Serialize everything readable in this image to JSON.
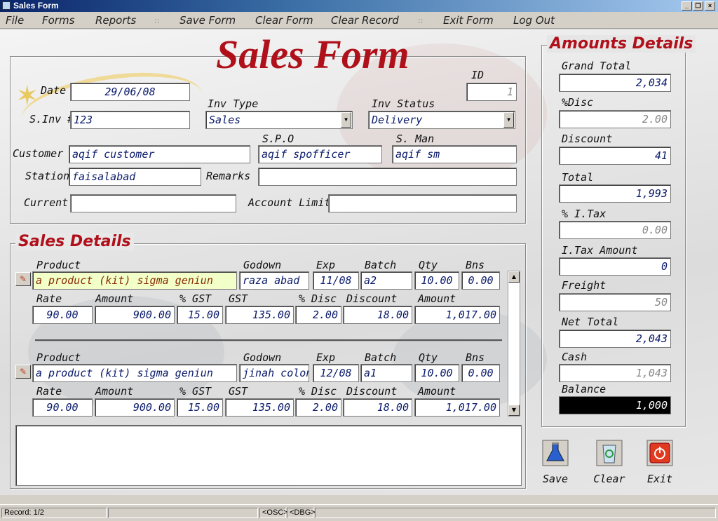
{
  "window": {
    "title": "Sales Form"
  },
  "menu": [
    {
      "label": "File"
    },
    {
      "label": "Forms"
    },
    {
      "label": "Reports"
    },
    {
      "label": "Save Form"
    },
    {
      "label": "Clear Form"
    },
    {
      "label": "Clear Record"
    },
    {
      "label": "Exit Form"
    },
    {
      "label": "Log Out"
    }
  ],
  "header": {
    "title": "Sales Form",
    "date_label": "Date",
    "date": "29/06/08",
    "id_label": "ID",
    "id": "1",
    "inv_type_label": "Inv Type",
    "inv_type": "Sales",
    "inv_status_label": "Inv Status",
    "inv_status": "Delivery",
    "sinv_label": "S.Inv #",
    "sinv": "123",
    "customer_label": "Customer",
    "customer": "aqif customer",
    "spo_label": "S.P.O",
    "spo": "aqif spofficer",
    "sman_label": "S. Man",
    "sman": "aqif sm",
    "station_label": "Station",
    "station": "faisalabad",
    "remarks_label": "Remarks",
    "remarks": "",
    "current_label": "Current",
    "current": "",
    "limit_label": "Account Limit",
    "limit": ""
  },
  "details": {
    "title": "Sales Details",
    "labels": {
      "product": "Product",
      "godown": "Godown",
      "exp": "Exp",
      "batch": "Batch",
      "qty": "Qty",
      "bns": "Bns",
      "rate": "Rate",
      "amount": "Amount",
      "pgst": "% GST",
      "gst": "GST",
      "pdisc": "% Disc",
      "discount": "Discount"
    },
    "rows": [
      {
        "product": "a product (kit) sigma geniun",
        "godown": "raza abad",
        "exp": "11/08",
        "batch": "a2",
        "qty": "10.00",
        "bns": "0.00",
        "rate": "90.00",
        "amount": "900.00",
        "pgst": "15.00",
        "gst": "135.00",
        "pdisc": "2.00",
        "discount": "18.00",
        "net": "1,017.00"
      },
      {
        "product": "a product (kit) sigma geniun",
        "godown": "jinah colony",
        "exp": "12/08",
        "batch": "a1",
        "qty": "10.00",
        "bns": "0.00",
        "rate": "90.00",
        "amount": "900.00",
        "pgst": "15.00",
        "gst": "135.00",
        "pdisc": "2.00",
        "discount": "18.00",
        "net": "1,017.00"
      }
    ]
  },
  "amounts": {
    "title": "Amounts Details",
    "grand_total_label": "Grand Total",
    "grand_total": "2,034",
    "pdisc_label": "%Disc",
    "pdisc": "2.00",
    "discount_label": "Discount",
    "discount": "41",
    "total_label": "Total",
    "total": "1,993",
    "pitax_label": "% I.Tax",
    "pitax": "0.00",
    "itax_label": "I.Tax Amount",
    "itax": "0",
    "freight_label": "Freight",
    "freight": "50",
    "net_total_label": "Net Total",
    "net_total": "2,043",
    "cash_label": "Cash",
    "cash": "1,043",
    "balance_label": "Balance",
    "balance": "1,000"
  },
  "actions": {
    "save": "Save",
    "clear": "Clear",
    "exit": "Exit"
  },
  "status": {
    "record": "Record: 1/2",
    "osc": "<OSC>",
    "dbg": "<DBG>"
  },
  "colors": {
    "accent": "#b0101a",
    "field_text": "#0a1a6a",
    "title_bar": "#0a246a"
  }
}
